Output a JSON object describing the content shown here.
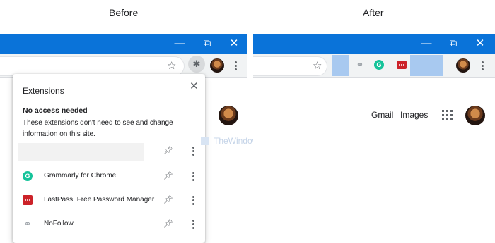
{
  "labels": {
    "before": "Before",
    "after": "After"
  },
  "window": {
    "minimize": "—",
    "restore": "⧉",
    "close": "✕"
  },
  "toolbar": {
    "bookmark_icon": "star-icon",
    "extensions_icon": "puzzle-icon"
  },
  "popup": {
    "title": "Extensions",
    "close": "✕",
    "section_heading": "No access needed",
    "section_desc": "These extensions don't need to see and change information on this site.",
    "pin_icon": "pin-icon",
    "items": [
      {
        "name": "",
        "icon": "blank"
      },
      {
        "name": "Grammarly for Chrome",
        "icon": "grammarly-icon"
      },
      {
        "name": "LastPass: Free Password Manager",
        "icon": "lastpass-icon"
      },
      {
        "name": "NoFollow",
        "icon": "link-icon"
      }
    ]
  },
  "watermark": {
    "text": "TheWindowsClub"
  },
  "google_bar": {
    "gmail": "Gmail",
    "images": "Images"
  },
  "colors": {
    "titlebar": "#0a73d9",
    "toolbar_bg": "#f1f3f4",
    "highlight": "#a8c9f0",
    "grammarly": "#15c39a",
    "lastpass": "#cc2229"
  }
}
